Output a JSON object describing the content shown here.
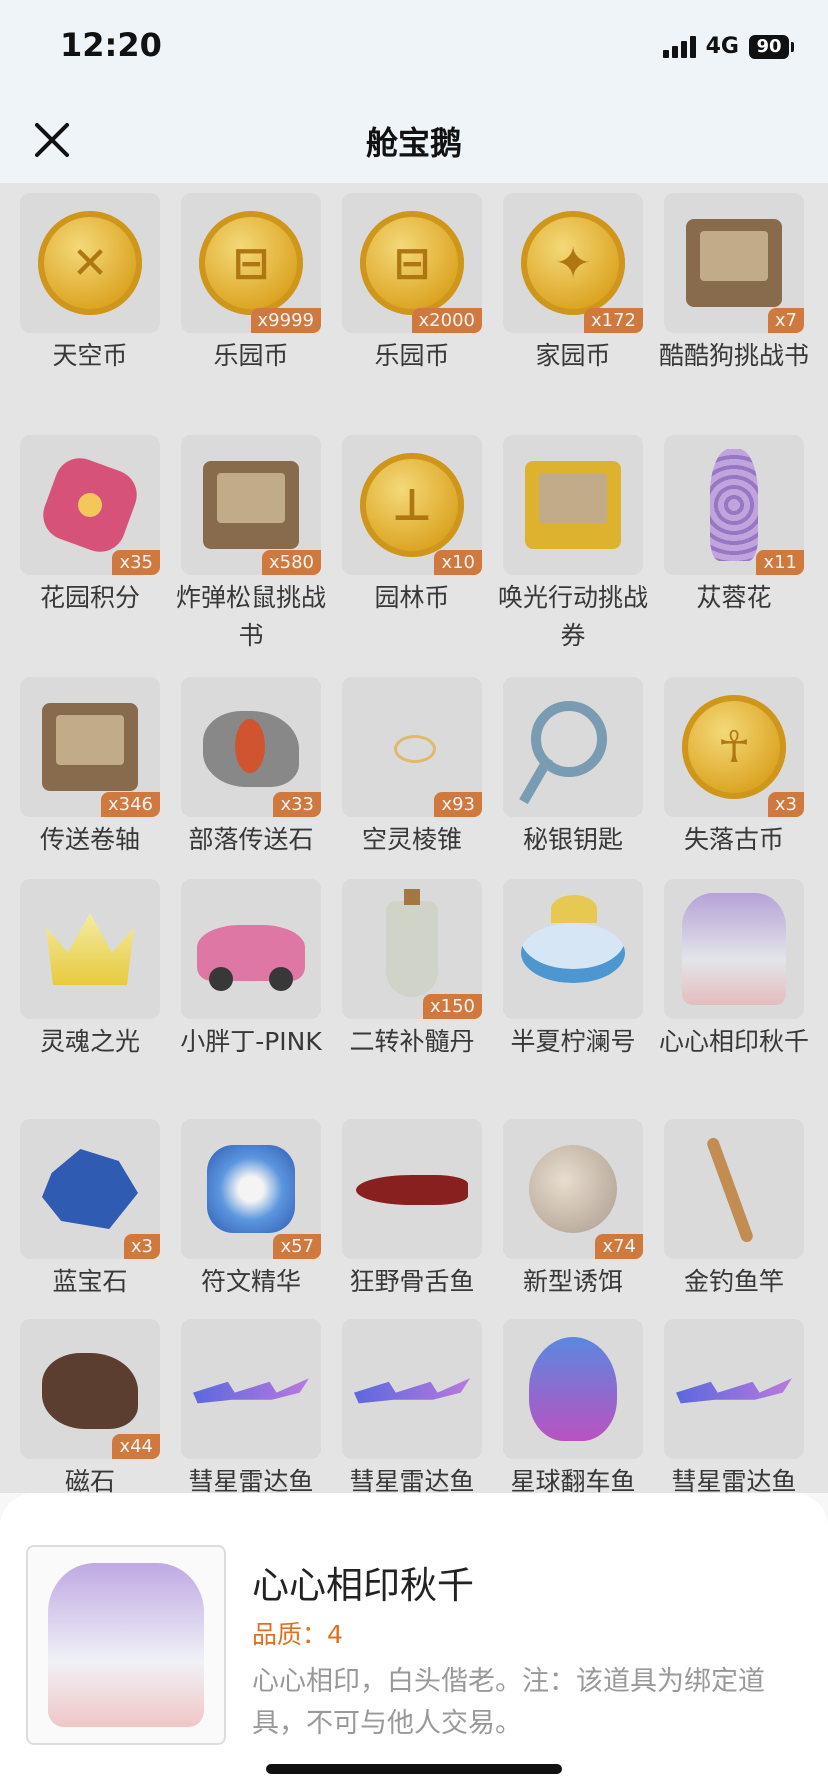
{
  "status_bar": {
    "time": "12:20",
    "network": "4G",
    "battery": "90"
  },
  "header": {
    "title": "舱宝鹅"
  },
  "items": [
    {
      "name": "天空币",
      "badge": "",
      "icon": "sky-coin-icon"
    },
    {
      "name": "乐园币",
      "badge": "x9999",
      "icon": "paradise-coin-icon"
    },
    {
      "name": "乐园币",
      "badge": "x2000",
      "icon": "paradise-coin-icon"
    },
    {
      "name": "家园币",
      "badge": "x172",
      "icon": "home-coin-icon"
    },
    {
      "name": "酷酷狗挑战书",
      "badge": "x7",
      "icon": "wanted-scroll-icon"
    },
    {
      "name": "花园积分",
      "badge": "x35",
      "icon": "garden-flower-icon"
    },
    {
      "name": "炸弹松鼠挑战书",
      "badge": "x580",
      "icon": "wanted-scroll-icon"
    },
    {
      "name": "园林币",
      "badge": "x10",
      "icon": "garden-coin-icon"
    },
    {
      "name": "唤光行动挑战券",
      "badge": "",
      "icon": "challenge-ticket-icon"
    },
    {
      "name": "苁蓉花",
      "badge": "x11",
      "icon": "cistanche-flower-icon"
    },
    {
      "name": "传送卷轴",
      "badge": "x346",
      "icon": "teleport-scroll-icon"
    },
    {
      "name": "部落传送石",
      "badge": "x33",
      "icon": "teleport-stone-icon"
    },
    {
      "name": "空灵棱锥",
      "badge": "x93",
      "icon": "ethereal-pyramid-icon"
    },
    {
      "name": "秘银钥匙",
      "badge": "",
      "icon": "mithril-key-icon"
    },
    {
      "name": "失落古币",
      "badge": "x3",
      "icon": "ancient-coin-icon"
    },
    {
      "name": "灵魂之光",
      "badge": "",
      "icon": "soul-light-icon"
    },
    {
      "name": "小胖丁-PINK",
      "badge": "",
      "icon": "pink-car-icon"
    },
    {
      "name": "二转补髓丹",
      "badge": "x150",
      "icon": "potion-bottle-icon"
    },
    {
      "name": "半夏柠澜号",
      "badge": "",
      "icon": "boat-icon"
    },
    {
      "name": "心心相印秋千",
      "badge": "",
      "icon": "swing-icon"
    },
    {
      "name": "蓝宝石",
      "badge": "x3",
      "icon": "sapphire-icon"
    },
    {
      "name": "符文精华",
      "badge": "x57",
      "icon": "rune-essence-icon"
    },
    {
      "name": "狂野骨舌鱼",
      "badge": "",
      "icon": "arowana-fish-icon"
    },
    {
      "name": "新型诱饵",
      "badge": "x74",
      "icon": "bait-icon"
    },
    {
      "name": "金钓鱼竿",
      "badge": "",
      "icon": "fishing-rod-icon"
    },
    {
      "name": "磁石",
      "badge": "x44",
      "icon": "magnet-stone-icon"
    },
    {
      "name": "彗星雷达鱼",
      "badge": "",
      "icon": "comet-fish-icon"
    },
    {
      "name": "彗星雷达鱼",
      "badge": "",
      "icon": "comet-fish-icon"
    },
    {
      "name": "星球翻车鱼",
      "badge": "",
      "icon": "sunfish-icon"
    },
    {
      "name": "彗星雷达鱼",
      "badge": "",
      "icon": "comet-fish-icon"
    }
  ],
  "detail": {
    "title": "心心相印秋千",
    "quality": "品质：4",
    "description": "心心相印，白头偕老。注：该道具为绑定道具，不可与他人交易。",
    "icon": "swing-icon"
  },
  "colors": {
    "badge": "#d87a3a",
    "quality": "#e07020",
    "header_bg": "#eef4f8"
  }
}
